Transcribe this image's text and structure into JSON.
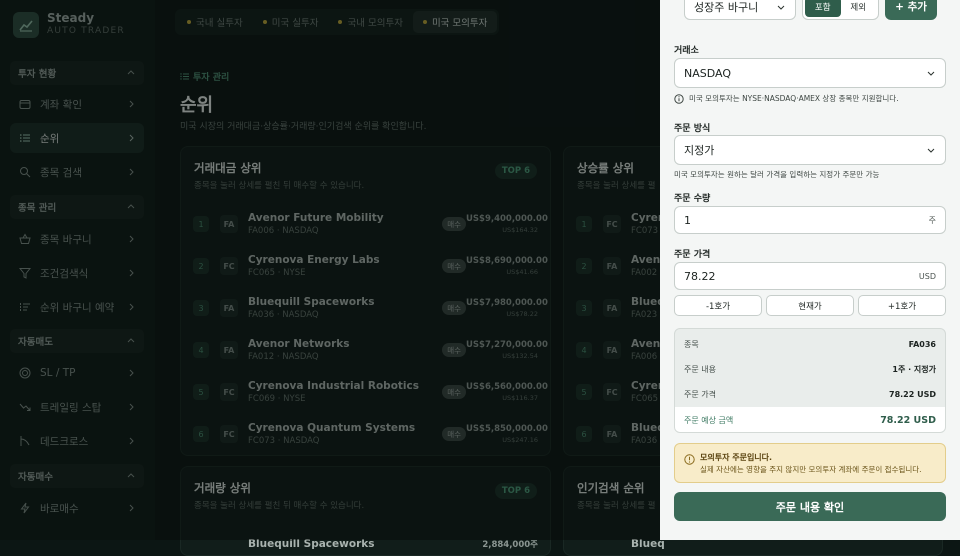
{
  "brand": {
    "title": "Steady",
    "subtitle": "AUTO TRADER"
  },
  "sidebar": {
    "sections": [
      {
        "label": "투자 현황",
        "items": [
          {
            "label": "계좌 확인",
            "icon": "wallet-icon"
          },
          {
            "label": "순위",
            "icon": "list-icon",
            "active": true
          },
          {
            "label": "종목 검색",
            "icon": "search-icon"
          }
        ]
      },
      {
        "label": "종목 관리",
        "items": [
          {
            "label": "종목 바구니",
            "icon": "basket-icon"
          },
          {
            "label": "조건검색식",
            "icon": "filter-icon"
          },
          {
            "label": "순위 바구니 예약",
            "icon": "list-clock-icon"
          }
        ]
      },
      {
        "label": "자동매도",
        "items": [
          {
            "label": "SL / TP",
            "icon": "target-icon"
          },
          {
            "label": "트레일링 스탑",
            "icon": "trend-down-icon"
          },
          {
            "label": "데드크로스",
            "icon": "cross-icon"
          }
        ]
      },
      {
        "label": "자동매수",
        "items": [
          {
            "label": "바로매수",
            "icon": "lightning-icon"
          }
        ]
      }
    ]
  },
  "tabs": [
    "국내 실투자",
    "미국 실투자",
    "국내 모의투자",
    "미국 모의투자"
  ],
  "active_tab": 3,
  "breadcrumb": "투자 관리",
  "page": {
    "title": "순위",
    "description": "미국 시장의 거래대금·상승률·거래량·인기검색 순위를 확인합니다."
  },
  "cards": {
    "trading_value": {
      "title": "거래대금 상위",
      "subtitle": "종목을 눌러 상세를 펼친 뒤 매수할 수 있습니다.",
      "badge": "TOP 6",
      "buy_label": "매수",
      "rows": [
        {
          "rank": "1",
          "tag": "FA",
          "name": "Avenor Future Mobility",
          "code": "FA006 · NASDAQ",
          "value": "US$9,400,000.00",
          "price": "US$164.32"
        },
        {
          "rank": "2",
          "tag": "FC",
          "name": "Cyrenova Energy Labs",
          "code": "FC065 · NYSE",
          "value": "US$8,690,000.00",
          "price": "US$41.66"
        },
        {
          "rank": "3",
          "tag": "FA",
          "name": "Bluequill Spaceworks",
          "code": "FA036 · NASDAQ",
          "value": "US$7,980,000.00",
          "price": "US$78.22"
        },
        {
          "rank": "4",
          "tag": "FA",
          "name": "Avenor Networks",
          "code": "FA012 · NASDAQ",
          "value": "US$7,270,000.00",
          "price": "US$132.54"
        },
        {
          "rank": "5",
          "tag": "FC",
          "name": "Cyrenova Industrial Robotics",
          "code": "FC069 · NYSE",
          "value": "US$6,560,000.00",
          "price": "US$116.37"
        },
        {
          "rank": "6",
          "tag": "FC",
          "name": "Cyrenova Quantum Systems",
          "code": "FC073 · NASDAQ",
          "value": "US$5,850,000.00",
          "price": "US$247.16"
        }
      ]
    },
    "gainers": {
      "title": "상승률 상위",
      "subtitle": "종목을 눌러 상세를 펼",
      "rows": [
        {
          "rank": "1",
          "tag": "FC",
          "name": "Cyren",
          "code": "FC073"
        },
        {
          "rank": "2",
          "tag": "FA",
          "name": "Avenc",
          "code": "FA002"
        },
        {
          "rank": "3",
          "tag": "FA",
          "name": "Blueq",
          "code": "FA023"
        },
        {
          "rank": "4",
          "tag": "FA",
          "name": "Avenc",
          "code": "FA006"
        },
        {
          "rank": "5",
          "tag": "FC",
          "name": "Cyren",
          "code": "FC065"
        },
        {
          "rank": "6",
          "tag": "FA",
          "name": "Blueq",
          "code": "FA036"
        }
      ]
    },
    "volume": {
      "title": "거래량 상위",
      "subtitle": "종목을 눌러 상세를 펼친 뒤 매수할 수 있습니다.",
      "badge": "TOP 6",
      "first_row_name": "Bluequill Spaceworks",
      "first_row_value": "2,884,000주"
    },
    "popular": {
      "title": "인기검색 순위",
      "subtitle": "종목을 눌러 상세를 펼",
      "first_row_name": "Blueq"
    }
  },
  "order_panel": {
    "basket_select": "성장주 바구니",
    "toggle": {
      "on": "포함",
      "off": "제외"
    },
    "add_button": "+ 추가",
    "exchange_label": "거래소",
    "exchange_value": "NASDAQ",
    "exchange_hint": "미국 모의투자는 NYSE·NASDAQ·AMEX 상장 종목만 지원합니다.",
    "order_type_label": "주문 방식",
    "order_type_value": "지정가",
    "order_type_hint": "미국 모의투자는 원하는 달러 가격을 입력하는 지정가 주문만 가능",
    "qty_label": "주문 수량",
    "qty_value": "1",
    "qty_unit": "주",
    "price_label": "주문 가격",
    "price_value": "78.22",
    "price_unit": "USD",
    "tick_buttons": [
      "-1호가",
      "현재가",
      "+1호가"
    ],
    "summary": [
      {
        "k": "종목",
        "v": "FA036"
      },
      {
        "k": "주문 내용",
        "v": "1주 · 지정가"
      },
      {
        "k": "주문 가격",
        "v": "78.22 USD"
      }
    ],
    "total": {
      "k": "주문 예상 금액",
      "v": "78.22 USD"
    },
    "warning_title": "모의투자 주문입니다.",
    "warning_text": "실제 자산에는 영향을 주지 않지만 모의투자 계좌에 주문이 접수됩니다.",
    "confirm_button": "주문 내용 확인"
  },
  "colors": {
    "accent": "#3a6a57",
    "brand_dark": "#0d1715",
    "warning_bg": "#f8ecc9"
  }
}
